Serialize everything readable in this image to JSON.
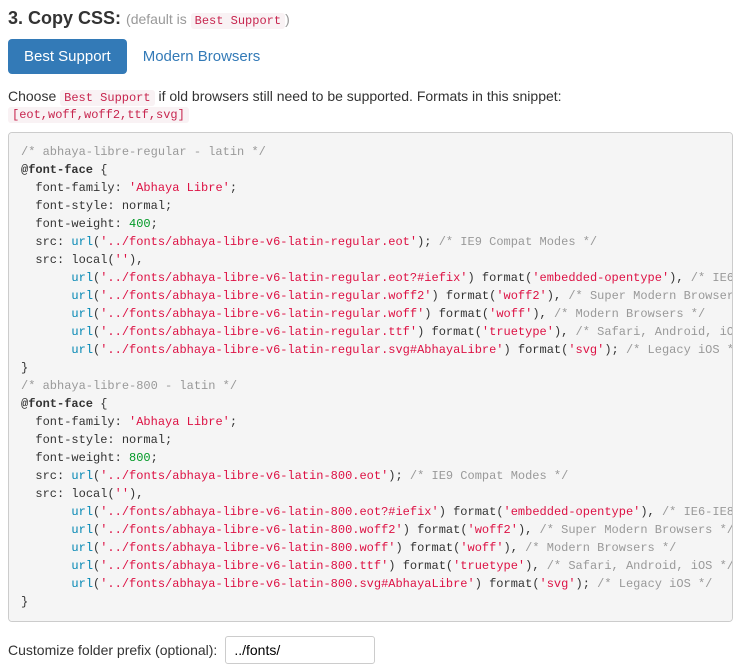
{
  "heading": {
    "title": "3. Copy CSS:",
    "sub_prefix": "(default is ",
    "sub_code": "Best Support",
    "sub_suffix": ")"
  },
  "tabs": {
    "best": "Best Support",
    "modern": "Modern Browsers"
  },
  "desc": {
    "p1": "Choose ",
    "code1": "Best Support",
    "p2": " if old browsers still need to be supported. Formats in this snippet: ",
    "code2": "[eot,woff,woff2,ttf,svg]"
  },
  "faces": [
    {
      "ds": "abhaya-libre-regular - latin",
      "fam": "'Abhaya Libre'",
      "st": "normal",
      "wt": "400",
      "eot": "'../fonts/abhaya-libre-v6-latin-regular.eot'",
      "eotfix": "'../fonts/abhaya-libre-v6-latin-regular.eot?#iefix'",
      "woff2": "'../fonts/abhaya-libre-v6-latin-regular.woff2'",
      "woff": "'../fonts/abhaya-libre-v6-latin-regular.woff'",
      "ttf": "'../fonts/abhaya-libre-v6-latin-regular.ttf'",
      "svg": "'../fonts/abhaya-libre-v6-latin-regular.svg#AbhayaLibre'"
    },
    {
      "ds": "abhaya-libre-800 - latin",
      "fam": "'Abhaya Libre'",
      "st": "normal",
      "wt": "800",
      "eot": "'../fonts/abhaya-libre-v6-latin-800.eot'",
      "eotfix": "'../fonts/abhaya-libre-v6-latin-800.eot?#iefix'",
      "woff2": "'../fonts/abhaya-libre-v6-latin-800.woff2'",
      "woff": "'../fonts/abhaya-libre-v6-latin-800.woff'",
      "ttf": "'../fonts/abhaya-libre-v6-latin-800.ttf'",
      "svg": "'../fonts/abhaya-libre-v6-latin-800.svg#AbhayaLibre'"
    }
  ],
  "fmt": {
    "eot_cmt": "IE9 Compat Modes",
    "local": "''",
    "eotfix_fmt": "'embedded-opentype'",
    "eotfix_cmt": "IE6-IE8",
    "woff2_fmt": "'woff2'",
    "woff2_cmt": "Super Modern Browsers",
    "woff_fmt": "'woff'",
    "woff_cmt": "Modern Browsers",
    "ttf_fmt": "'truetype'",
    "ttf_cmt": "Safari, Android, iOS",
    "svg_fmt": "'svg'",
    "svg_cmt": "Legacy iOS"
  },
  "footer": {
    "label": "Customize folder prefix (optional):",
    "value": "../fonts/"
  }
}
